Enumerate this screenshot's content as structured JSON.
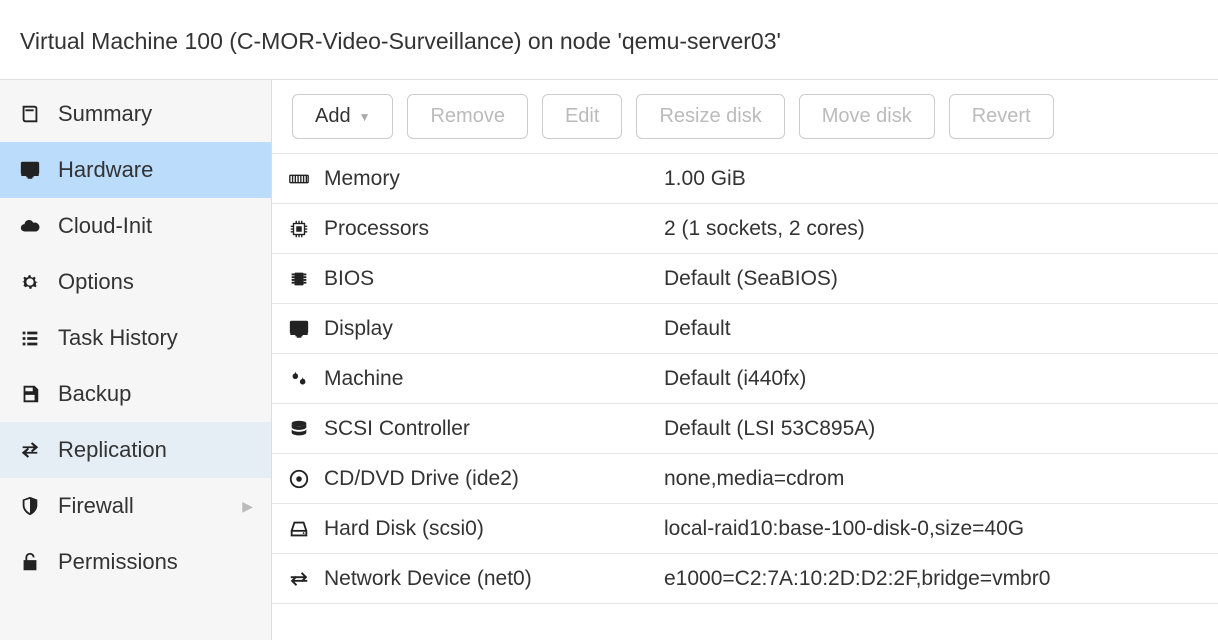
{
  "header": {
    "title": "Virtual Machine 100 (C-MOR-Video-Surveillance) on node 'qemu-server03'"
  },
  "sidebar": {
    "items": [
      {
        "label": "Summary",
        "icon": "book",
        "selected": false
      },
      {
        "label": "Hardware",
        "icon": "desktop",
        "selected": true
      },
      {
        "label": "Cloud-Init",
        "icon": "cloud",
        "selected": false
      },
      {
        "label": "Options",
        "icon": "gear",
        "selected": false
      },
      {
        "label": "Task History",
        "icon": "list",
        "selected": false
      },
      {
        "label": "Backup",
        "icon": "save",
        "selected": false
      },
      {
        "label": "Replication",
        "icon": "exchange",
        "selected": false,
        "hover": true
      },
      {
        "label": "Firewall",
        "icon": "shield",
        "selected": false,
        "expandable": true
      },
      {
        "label": "Permissions",
        "icon": "unlock",
        "selected": false
      }
    ]
  },
  "toolbar": {
    "add_label": "Add",
    "remove_label": "Remove",
    "edit_label": "Edit",
    "resize_label": "Resize disk",
    "move_label": "Move disk",
    "revert_label": "Revert"
  },
  "hardware": {
    "rows": [
      {
        "icon": "memory",
        "label": "Memory",
        "value": "1.00 GiB"
      },
      {
        "icon": "cpu",
        "label": "Processors",
        "value": "2 (1 sockets, 2 cores)"
      },
      {
        "icon": "chip",
        "label": "BIOS",
        "value": "Default (SeaBIOS)"
      },
      {
        "icon": "desktop",
        "label": "Display",
        "value": "Default"
      },
      {
        "icon": "cogs",
        "label": "Machine",
        "value": "Default (i440fx)"
      },
      {
        "icon": "database",
        "label": "SCSI Controller",
        "value": "Default (LSI 53C895A)"
      },
      {
        "icon": "disc",
        "label": "CD/DVD Drive (ide2)",
        "value": "none,media=cdrom"
      },
      {
        "icon": "hdd",
        "label": "Hard Disk (scsi0)",
        "value": "local-raid10:base-100-disk-0,size=40G"
      },
      {
        "icon": "network",
        "label": "Network Device (net0)",
        "value": "e1000=C2:7A:10:2D:D2:2F,bridge=vmbr0"
      }
    ]
  }
}
